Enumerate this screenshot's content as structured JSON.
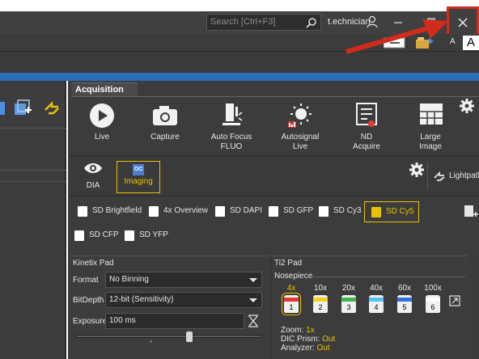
{
  "titlebar": {
    "search_placeholder": "Search [Ctrl+F3]",
    "user": "t.echnician"
  },
  "font_size": {
    "small": "A",
    "big": "A"
  },
  "acquisition": {
    "tab": "Acquisition",
    "buttons": [
      {
        "icon": "play-icon",
        "label": "Live"
      },
      {
        "icon": "camera-icon",
        "label": "Capture"
      },
      {
        "icon": "autofocus-icon",
        "label": "Auto Focus\nFLUO"
      },
      {
        "icon": "autosignal-icon",
        "label": "Autosignal\nLive"
      },
      {
        "icon": "nd-acquire-icon",
        "label": "ND\nAcquire"
      },
      {
        "icon": "large-image-icon",
        "label": "Large\nImage"
      }
    ]
  },
  "optical_config": {
    "dia_label": "DIA",
    "imaging_label": "Imaging",
    "imaging_badge": "OC",
    "lightpath_label": "Lightpath"
  },
  "presets": [
    {
      "label": "SD Brightfield",
      "active": false
    },
    {
      "label": "4x Overview",
      "active": false
    },
    {
      "label": "SD DAPI",
      "active": false
    },
    {
      "label": "SD GFP",
      "active": false
    },
    {
      "label": "SD Cy3",
      "active": false
    },
    {
      "label": "SD Cy5",
      "active": true
    },
    {
      "label": "SD CFP",
      "active": false
    },
    {
      "label": "SD YFP",
      "active": false
    }
  ],
  "kinetix": {
    "title": "Kinetix Pad",
    "format_label": "Format",
    "format_value": "No Binning",
    "bitdepth_label": "BitDepth",
    "bitdepth_value": "12-bit (Sensitivity)",
    "exposure_label": "Exposure",
    "exposure_value": "100 ms"
  },
  "ti2": {
    "title": "Ti2 Pad",
    "nosepiece_label": "Nosepiece",
    "objectives": [
      {
        "mag": "4x",
        "num": "1",
        "color": "#e53935",
        "active": true
      },
      {
        "mag": "10x",
        "num": "2",
        "color": "#f2d21b",
        "active": false
      },
      {
        "mag": "20x",
        "num": "3",
        "color": "#3cb84a",
        "active": false
      },
      {
        "mag": "40x",
        "num": "4",
        "color": "#4fc3f7",
        "active": false
      },
      {
        "mag": "60x",
        "num": "5",
        "color": "#2f6fd8",
        "active": false
      },
      {
        "mag": "100x",
        "num": "6",
        "color": "#ffffff",
        "active": false
      }
    ],
    "zoom_label": "Zoom:",
    "zoom_value": "1x",
    "dic_label": "DIC Prism:",
    "dic_value": "Out",
    "analyzer_label": "Analyzer:",
    "analyzer_value": "Out"
  },
  "colors": {
    "accent": "#e8c400",
    "annotation": "#d12b1c",
    "titlebar": "#404040",
    "panel": "#3c3c3c",
    "blue_bar": "#2b6cb8"
  }
}
